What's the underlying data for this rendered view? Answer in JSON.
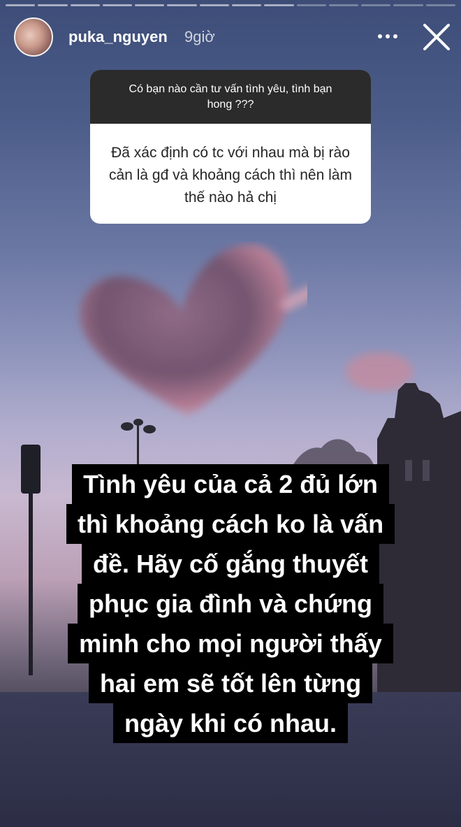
{
  "story": {
    "username": "puka_nguyen",
    "time": "9giờ",
    "progress_segments": 14
  },
  "question": {
    "header": "Có bạn nào cần tư vấn tình yêu, tình bạn hong ???",
    "body": "Đã xác định có tc với nhau mà bị rào cản là gđ và khoảng cách thì nên làm thế nào hả chị"
  },
  "answer": {
    "lines": [
      "Tình yêu của cả 2 đủ lớn",
      "thì khoảng cách ko là vấn",
      "đề.  Hãy cố gắng thuyết",
      "phục gia đình và chứng",
      "minh cho mọi người thấy",
      "hai em sẽ tốt lên từng",
      "ngày khi có nhau."
    ]
  },
  "icons": {
    "more": "more-horizontal-icon",
    "close": "close-icon"
  },
  "colors": {
    "text_highlight_bg": "#000000",
    "question_header_bg": "#2b2b2b"
  }
}
